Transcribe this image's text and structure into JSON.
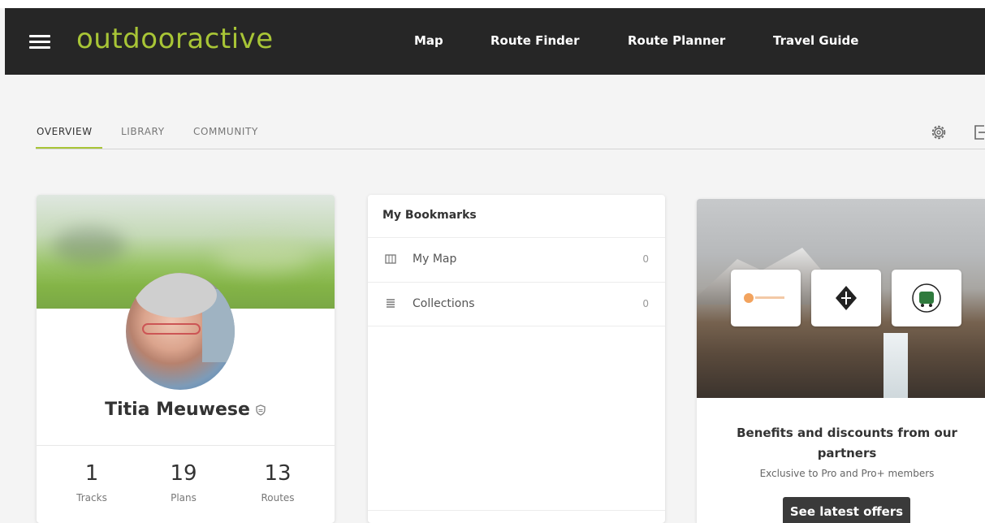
{
  "header": {
    "logo": "outdooractive",
    "nav": [
      "Map",
      "Route Finder",
      "Route Planner",
      "Travel Guide"
    ]
  },
  "tabs": [
    "OVERVIEW",
    "LIBRARY",
    "COMMUNITY"
  ],
  "active_tab": "OVERVIEW",
  "profile": {
    "name": "Titia Meuwese",
    "stats": [
      {
        "value": "1",
        "label": "Tracks"
      },
      {
        "value": "19",
        "label": "Plans"
      },
      {
        "value": "13",
        "label": "Routes"
      }
    ]
  },
  "bookmarks": {
    "title": "My Bookmarks",
    "items": [
      {
        "label": "My Map",
        "count": "0",
        "icon": "map-icon"
      },
      {
        "label": "Collections",
        "count": "0",
        "icon": "list-icon"
      }
    ]
  },
  "partners": {
    "title": "Benefits and discounts from our partners",
    "subtitle": "Exclusive to Pro and Pro+ members",
    "button": "See latest offers"
  },
  "colors": {
    "navbar": "#262626",
    "accent": "#a8c536",
    "button": "#3a3a3a"
  }
}
